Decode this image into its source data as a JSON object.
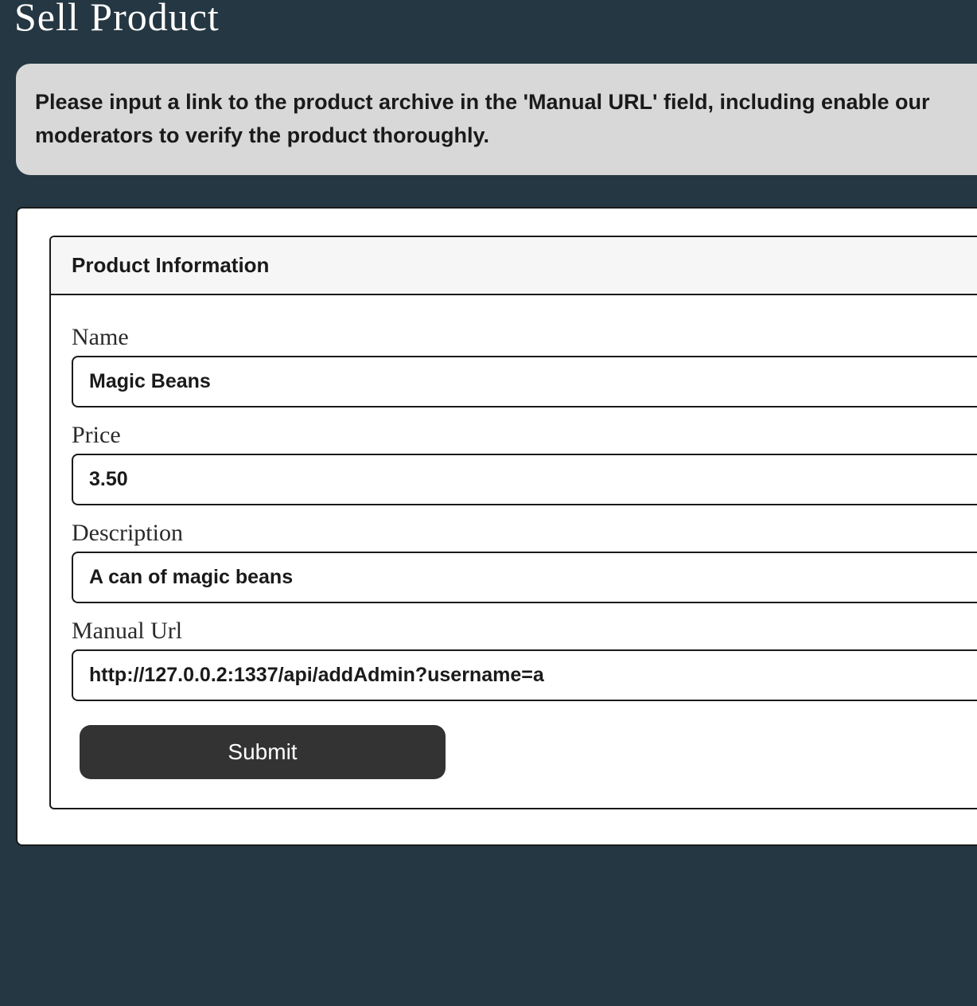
{
  "page_title": "Sell Product",
  "alert": {
    "message": "Please input a link to the product archive in the 'Manual URL' field, including enable our moderators to verify the product thoroughly."
  },
  "form": {
    "legend": "Product Information",
    "fields": {
      "name": {
        "label": "Name",
        "value": "Magic Beans"
      },
      "price": {
        "label": "Price",
        "value": "3.50"
      },
      "description": {
        "label": "Description",
        "value": "A can of magic beans"
      },
      "manual_url": {
        "label": "Manual Url",
        "value": "http://127.0.0.2:1337/api/addAdmin?username=a"
      }
    },
    "submit_label": "Submit"
  }
}
